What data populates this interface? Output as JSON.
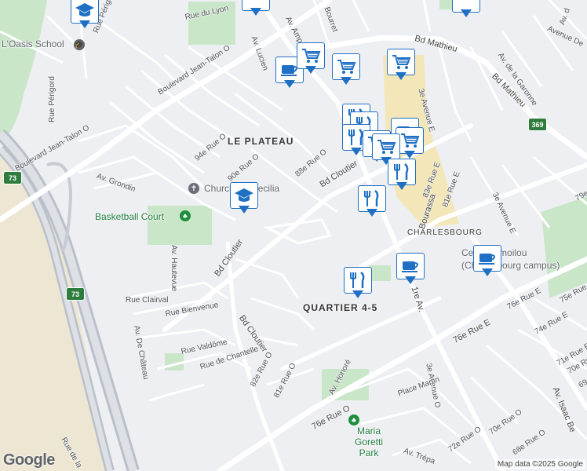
{
  "map": {
    "neighborhoods": {
      "le_plateau": "LE PLATEAU",
      "charlesbourg": "CHARLESBOURG",
      "quartier": "QUARTIER 4-5"
    },
    "pois": {
      "oasis_school": "L'Oasis School",
      "church": "Church St. Cecilia",
      "basketball": "Basketball Court",
      "limoilou": "Cegep Limoilou (Charlesbourg campus)",
      "maria_goretti": "Maria Goretti Park"
    },
    "streets": {
      "perigord_top": "Rue Périgord",
      "perigord": "Rue Périgord",
      "lyon": "Rue du Lyon",
      "jean_talon_1": "Boulevard Jean-Talon O",
      "jean_talon_2": "Boulevard Jean-Talon O",
      "av_lucien": "Av. Lucien",
      "av_ampere": "Av. Ampère",
      "bourret": "Bourret",
      "bd_mathieu_1": "Bd Mathieu",
      "bd_mathieu_2": "Bd Mathieu",
      "bd_mathieu_3": "Bd Mathieu",
      "av_garonne": "Av. de la Garonne",
      "avenue_de": "Avenue De",
      "av_d": "Av. d",
      "rue_94e": "94e Rue O",
      "rue_90e": "90e Rue O",
      "rue_88e": "88e Rue O",
      "bd_cloutier_1": "Bd Cloutier",
      "bd_cloutier_2": "Bd Cloutier",
      "bd_cloutier_3": "Bd Cloutier",
      "av_grondin": "Av. Grondin",
      "av_hautevue": "Av. Hautevue",
      "rue_clairval": "Rue Clairval",
      "rue_bienvenue": "Rue Bienvenue",
      "av_de_chateau": "Av. De Château",
      "rue_valdome": "Rue Valdôme",
      "rue_chantelle": "Rue de Chantelle",
      "rue_82e": "82e Rue O",
      "rue_81e": "81e Rue O",
      "av_honore": "Av. Honoré",
      "rue_76e_o": "76e Rue O",
      "rue_76e_e": "76e Rue E",
      "rue_76e_e2": "76e Rue E",
      "av_1re": "1re Av.",
      "av_3e": "3e Avenue O",
      "avenue_3e_e": "3e Avenue E",
      "av_3e_e2": "3e Avenue E",
      "rue_83e": "83e Rue E",
      "rue_81e_e": "81e Rue E",
      "bourassa": "Bourassa",
      "rue_79e": "79e",
      "rue_75e": "75e Rue",
      "rue_74e": "74e Rue E",
      "rue_71e": "71e Rue E",
      "rue_70e": "70e Rue",
      "rue_69e": "69e",
      "av_isaac": "Av. Isaac Be",
      "place_martin": "Place Martin",
      "rue_70e_o": "70e Rue O",
      "rue_68e": "68e Rue O",
      "rue_72e": "72e Rue O",
      "av_trepanier": "Av. Trépa",
      "rue_de_la": "Rue de la"
    },
    "highway_73": "73",
    "highway_369": "369",
    "logo": "Google",
    "attribution": "Map data ©2025 Google",
    "colors": {
      "marker_border": "#1f6fc4",
      "park": "#c9e6c9",
      "commercial": "#f3e6b8",
      "highway": "#b9c0ca",
      "road": "#ffffff"
    },
    "markers": [
      {
        "type": "school-icon",
        "name": "marker-school-top"
      },
      {
        "type": "school-icon",
        "name": "marker-school-church"
      },
      {
        "type": "cafe-icon",
        "name": "marker-cafe-north"
      },
      {
        "type": "cafe-icon",
        "name": "marker-cafe-1re-av"
      },
      {
        "type": "cafe-icon",
        "name": "marker-cafe-limoilou"
      },
      {
        "type": "grocery-icon",
        "name": "marker-grocery-1"
      },
      {
        "type": "grocery-icon",
        "name": "marker-grocery-2"
      },
      {
        "type": "grocery-icon",
        "name": "marker-grocery-3"
      },
      {
        "type": "grocery-icon",
        "name": "marker-grocery-4"
      },
      {
        "type": "restaurant-icon",
        "name": "marker-restaurant-cluster"
      },
      {
        "type": "restaurant-icon",
        "name": "marker-restaurant-2"
      },
      {
        "type": "restaurant-icon",
        "name": "marker-restaurant-3"
      },
      {
        "type": "restaurant-icon",
        "name": "marker-restaurant-4"
      },
      {
        "type": "restaurant-icon",
        "name": "marker-restaurant-quartier"
      }
    ]
  }
}
